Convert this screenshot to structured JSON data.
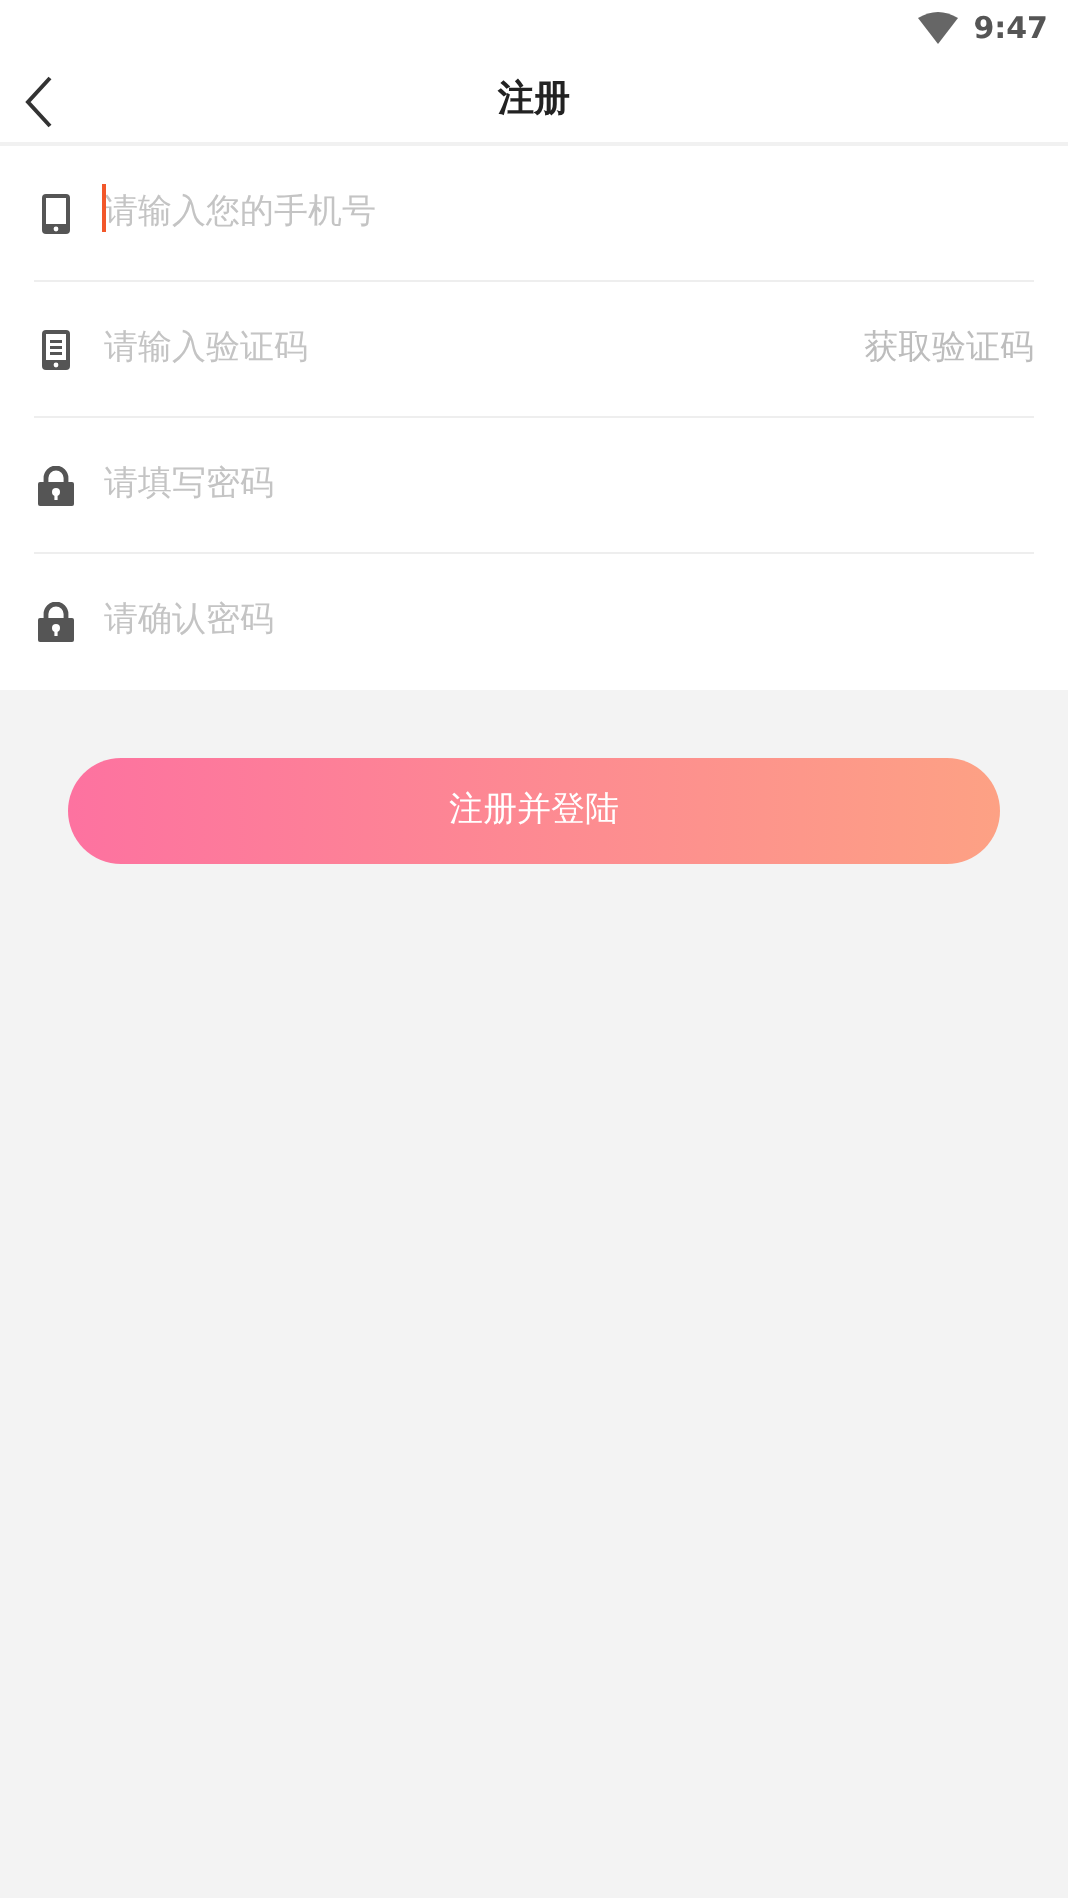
{
  "status_bar": {
    "time": "9:47"
  },
  "header": {
    "title": "注册"
  },
  "fields": [
    {
      "kind": "phone",
      "placeholder": "请输入您的手机号",
      "focused": true
    },
    {
      "kind": "code",
      "placeholder": "请输入验证码",
      "focused": false,
      "action": "获取验证码"
    },
    {
      "kind": "password",
      "placeholder": "请填写密码",
      "focused": false
    },
    {
      "kind": "password",
      "placeholder": "请确认密码",
      "focused": false
    }
  ],
  "submit": {
    "label": "注册并登陆"
  }
}
